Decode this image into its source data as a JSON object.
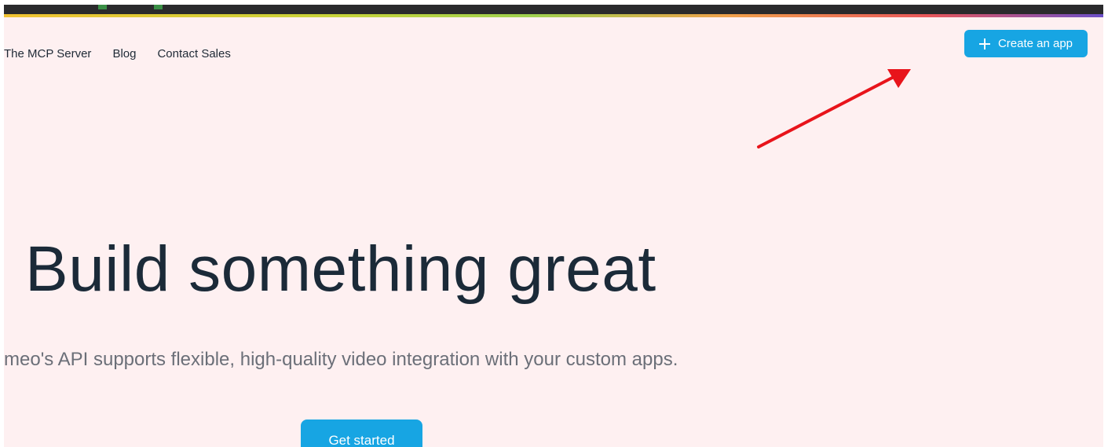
{
  "nav": {
    "items": [
      {
        "label": "The MCP Server"
      },
      {
        "label": "Blog"
      },
      {
        "label": "Contact Sales"
      }
    ]
  },
  "header": {
    "create_label": "Create an app",
    "create_icon": "plus-icon"
  },
  "hero": {
    "title": "Build something great",
    "subtitle": "meo's API supports flexible, high-quality video integration with your custom apps.",
    "cta_label": "Get started"
  },
  "annotation": {
    "arrow_icon": "red-arrow-annotation",
    "arrow_color": "#e8141b"
  },
  "colors": {
    "accent": "#17a5e3",
    "page_background": "#fef0f1",
    "title_text": "#1b2a38"
  }
}
